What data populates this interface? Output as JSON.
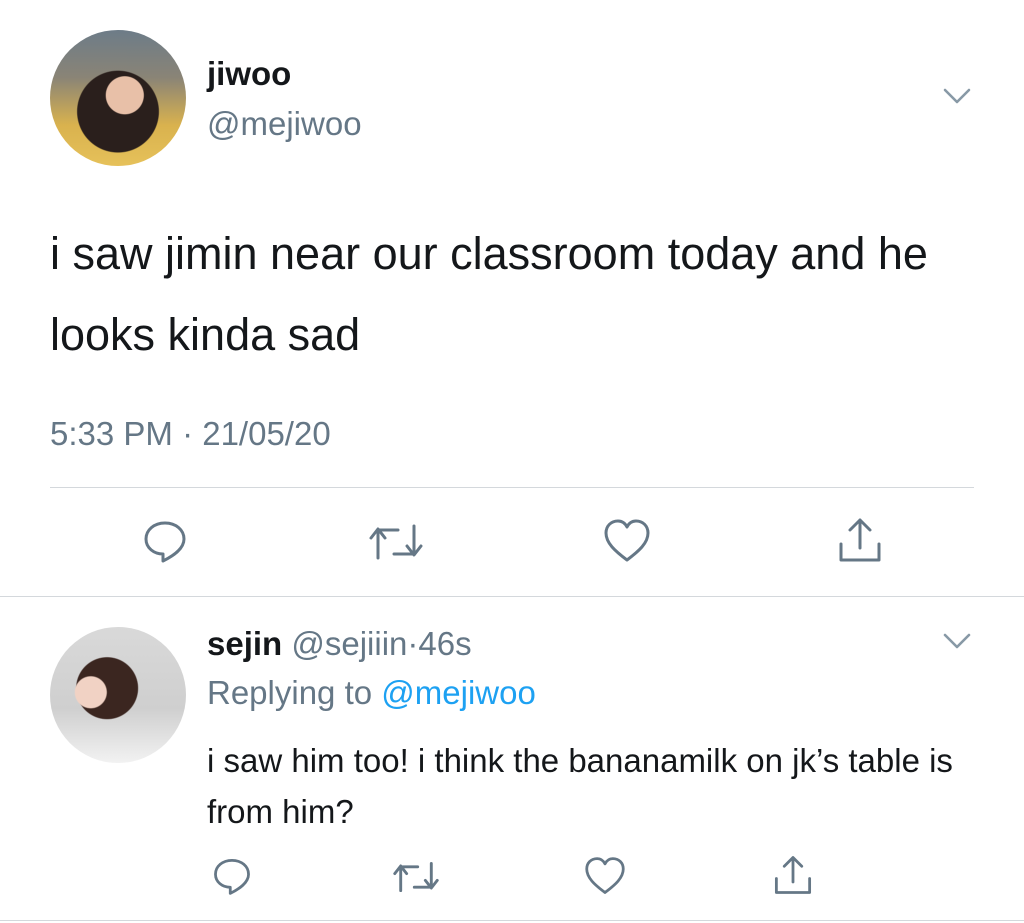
{
  "tweet": {
    "author_name": "jiwoo",
    "author_handle": "@mejiwoo",
    "text": "i saw jimin near our classroom today and he looks kinda sad",
    "timestamp": "5:33 PM · 21/05/20"
  },
  "reply": {
    "author_name": "sejin",
    "author_handle": "@sejiiin",
    "separator": "·",
    "time_ago": "46s",
    "replying_to_label": "Replying to",
    "replying_to_handle": "@mejiwoo",
    "text": "i saw him too! i think the bananamilk on jk’s table is from him?"
  },
  "icons": {
    "reply": "reply-icon",
    "retweet": "retweet-icon",
    "like": "heart-icon",
    "share": "share-icon",
    "menu": "chevron-down-icon"
  },
  "colors": {
    "text": "#14171a",
    "secondary": "#657786",
    "link": "#1da1f2",
    "divider": "#d4d8dc"
  }
}
